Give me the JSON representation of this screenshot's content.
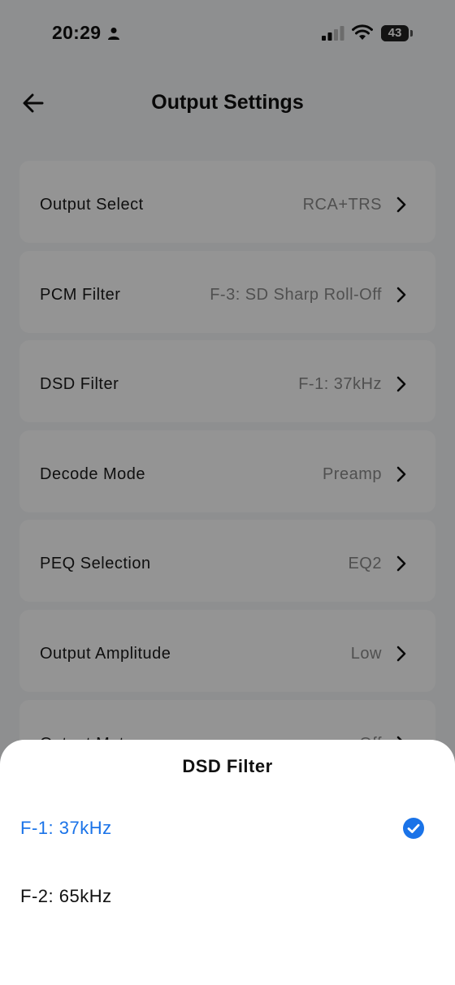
{
  "status_bar": {
    "time": "20:29",
    "battery_level": "43",
    "battery_fraction": 0.43
  },
  "header": {
    "title": "Output Settings"
  },
  "settings": [
    {
      "label": "Output Select",
      "value": "RCA+TRS"
    },
    {
      "label": "PCM Filter",
      "value": "F-3: SD Sharp Roll-Off"
    },
    {
      "label": "DSD Filter",
      "value": "F-1: 37kHz"
    },
    {
      "label": "Decode Mode",
      "value": "Preamp"
    },
    {
      "label": "PEQ Selection",
      "value": "EQ2"
    },
    {
      "label": "Output Amplitude",
      "value": "Low"
    },
    {
      "label": "Output Mute",
      "value": "Off"
    }
  ],
  "sheet": {
    "title": "DSD Filter",
    "options": [
      {
        "label": "F-1: 37kHz",
        "selected": true
      },
      {
        "label": "F-2: 65kHz",
        "selected": false
      }
    ]
  },
  "colors": {
    "accent": "#1a73e8",
    "text": "#1a1a1a",
    "secondary_text": "#8a8a8a"
  }
}
